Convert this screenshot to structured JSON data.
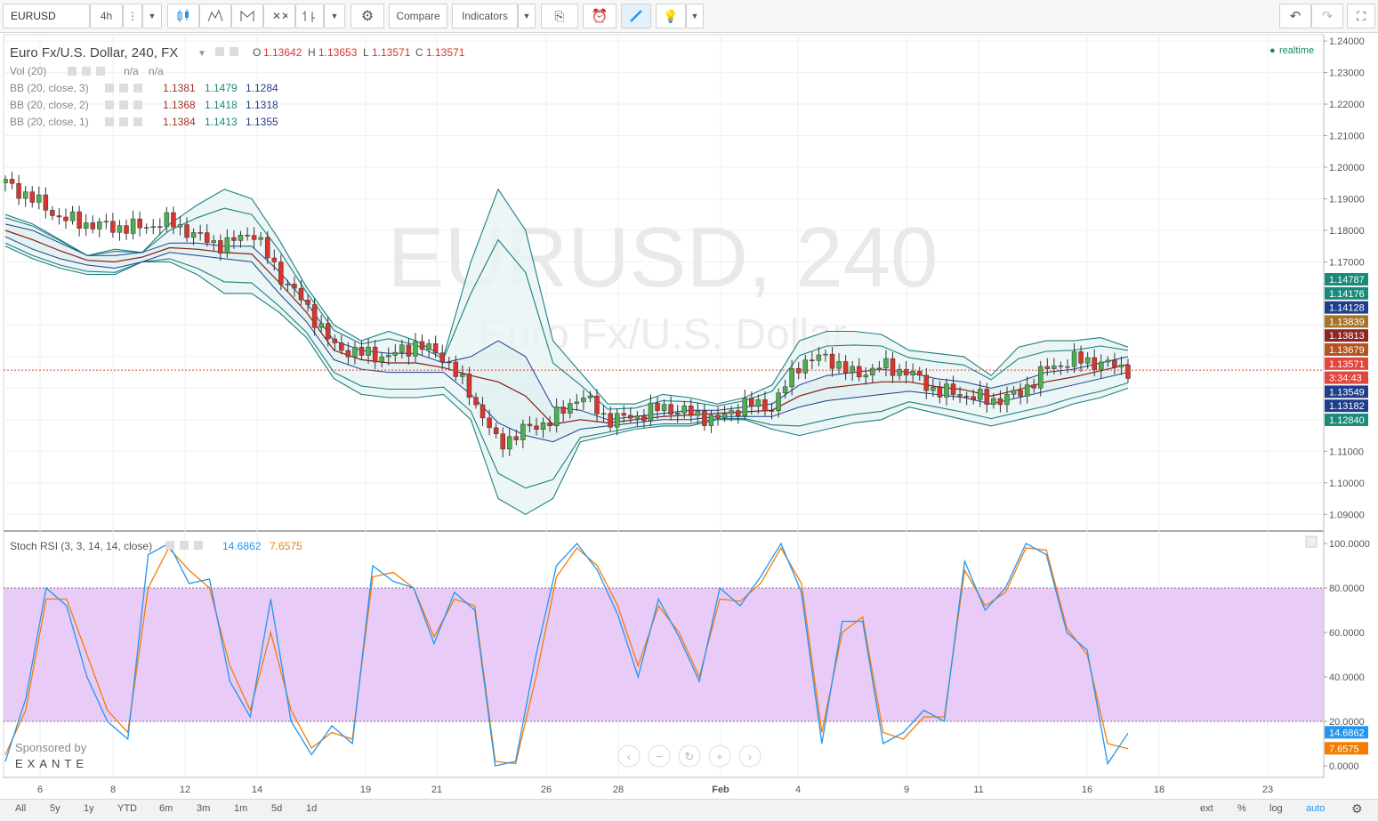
{
  "toolbar": {
    "symbol": "EURUSD",
    "interval": "4h",
    "compare_label": "Compare",
    "indicators_label": "Indicators"
  },
  "legend": {
    "title": "Euro Fx/U.S. Dollar, 240, FX",
    "o_label": "O",
    "o": "1.13642",
    "h_label": "H",
    "h": "1.13653",
    "l_label": "L",
    "l": "1.13571",
    "c_label": "C",
    "c": "1.13571",
    "vol_label": "Vol (20)",
    "vol_v1": "n/a",
    "vol_v2": "n/a",
    "bb": [
      {
        "label": "BB (20, close, 3)",
        "v1": "1.1381",
        "v2": "1.1479",
        "v3": "1.1284"
      },
      {
        "label": "BB (20, close, 2)",
        "v1": "1.1368",
        "v2": "1.1418",
        "v3": "1.1318"
      },
      {
        "label": "BB (20, close, 1)",
        "v1": "1.1384",
        "v2": "1.1413",
        "v3": "1.1355"
      }
    ],
    "realtime": "realtime"
  },
  "watermark": {
    "main": "EURUSD, 240",
    "sub": "Euro Fx/U.S. Dollar"
  },
  "stoch": {
    "label": "Stoch RSI (3, 3, 14, 14, close)",
    "k": "14.6862",
    "d": "7.6575"
  },
  "sponsor": {
    "line1": "Sponsored by",
    "line2": "EXANTE"
  },
  "price_axis": {
    "ticks": [
      "1.24000",
      "1.23000",
      "1.22000",
      "1.21000",
      "1.20000",
      "1.19000",
      "1.18000",
      "1.17000",
      "1.11000",
      "1.10000",
      "1.09000"
    ],
    "tags": [
      {
        "text": "1.14787",
        "color": "#1a8a7a"
      },
      {
        "text": "1.14176",
        "color": "#1a8a7a"
      },
      {
        "text": "1.14128",
        "color": "#1f3e8c"
      },
      {
        "text": "1.13839",
        "color": "#a5732a"
      },
      {
        "text": "1.13813",
        "color": "#8f2424"
      },
      {
        "text": "1.13679",
        "color": "#b5541f"
      },
      {
        "text": "1.13571",
        "color": "#e2463c"
      },
      {
        "text": "3:34:43",
        "color": "#e2463c"
      },
      {
        "text": "1.13549",
        "color": "#1f3e8c"
      },
      {
        "text": "1.13182",
        "color": "#1f3e8c"
      },
      {
        "text": "1.12840",
        "color": "#1a8a7a"
      }
    ]
  },
  "stoch_axis": {
    "ticks": [
      "100.0000",
      "80.0000",
      "60.0000",
      "40.0000",
      "20.0000",
      "0.0000"
    ],
    "k_tag": "14.6862",
    "d_tag": "7.6575",
    "k_color": "#2196f3",
    "d_color": "#f57c00"
  },
  "time_axis": [
    "6",
    "8",
    "12",
    "14",
    "19",
    "21",
    "26",
    "28",
    "Feb",
    "4",
    "9",
    "11",
    "16",
    "18",
    "23"
  ],
  "ranges": [
    "All",
    "5y",
    "1y",
    "YTD",
    "6m",
    "3m",
    "1m",
    "5d",
    "1d"
  ],
  "bottom_right": [
    "ext",
    "%",
    "log",
    "auto"
  ],
  "colors": {
    "up": "#4caf50",
    "down": "#d9352c",
    "band": "#1a7f80",
    "band_fill": "#e8f4f4",
    "basis": "#8b1a1a",
    "stoch_bg": "#e8ccf7",
    "last_price": "#e2463c"
  },
  "chart_data": [
    {
      "type": "candlestick",
      "title": "Euro Fx/U.S. Dollar, 240, FX",
      "ylim": [
        1.085,
        1.242
      ],
      "x_ticks": [
        "6",
        "8",
        "12",
        "14",
        "19",
        "21",
        "26",
        "28",
        "Feb",
        "4",
        "9",
        "11",
        "16",
        "18",
        "23"
      ],
      "last_close": 1.13571,
      "series": [
        {
          "name": "BB (20, close, 3) upper",
          "values": [
            1.185,
            1.182,
            1.177,
            1.172,
            1.174,
            1.173,
            1.182,
            1.188,
            1.193,
            1.19,
            1.177,
            1.162,
            1.15,
            1.145,
            1.148,
            1.145,
            1.14,
            1.17,
            1.193,
            1.18,
            1.145,
            1.135,
            1.125,
            1.125,
            1.128,
            1.127,
            1.125,
            1.127,
            1.131,
            1.145,
            1.148,
            1.148,
            1.147,
            1.142,
            1.141,
            1.14,
            1.134,
            1.143,
            1.145,
            1.145,
            1.146,
            1.143
          ]
        },
        {
          "name": "BB (20, close, 3) lower",
          "values": [
            1.175,
            1.171,
            1.168,
            1.166,
            1.166,
            1.17,
            1.17,
            1.166,
            1.16,
            1.16,
            1.154,
            1.146,
            1.133,
            1.128,
            1.127,
            1.127,
            1.128,
            1.12,
            1.095,
            1.09,
            1.095,
            1.113,
            1.115,
            1.117,
            1.118,
            1.118,
            1.12,
            1.12,
            1.117,
            1.115,
            1.117,
            1.119,
            1.12,
            1.124,
            1.122,
            1.12,
            1.118,
            1.12,
            1.122,
            1.125,
            1.127,
            1.13
          ]
        },
        {
          "name": "BB (20, close, 1) upper",
          "values": [
            1.182,
            1.18,
            1.176,
            1.172,
            1.172,
            1.173,
            1.176,
            1.176,
            1.175,
            1.175,
            1.167,
            1.157,
            1.145,
            1.142,
            1.141,
            1.141,
            1.138,
            1.14,
            1.145,
            1.14,
            1.124,
            1.123,
            1.12,
            1.121,
            1.122,
            1.123,
            1.123,
            1.124,
            1.125,
            1.131,
            1.134,
            1.135,
            1.136,
            1.135,
            1.133,
            1.132,
            1.13,
            1.132,
            1.135,
            1.136,
            1.138,
            1.14
          ]
        },
        {
          "name": "BB (20, close, 1) lower",
          "values": [
            1.178,
            1.174,
            1.171,
            1.169,
            1.168,
            1.17,
            1.173,
            1.172,
            1.171,
            1.17,
            1.16,
            1.151,
            1.139,
            1.136,
            1.135,
            1.135,
            1.135,
            1.128,
            1.119,
            1.115,
            1.113,
            1.117,
            1.118,
            1.119,
            1.12,
            1.12,
            1.121,
            1.121,
            1.121,
            1.124,
            1.126,
            1.127,
            1.128,
            1.129,
            1.128,
            1.127,
            1.125,
            1.127,
            1.129,
            1.131,
            1.133,
            1.135
          ]
        },
        {
          "name": "Close",
          "values": [
            1.195,
            1.19,
            1.184,
            1.182,
            1.181,
            1.181,
            1.183,
            1.178,
            1.175,
            1.18,
            1.166,
            1.156,
            1.143,
            1.141,
            1.14,
            1.144,
            1.14,
            1.128,
            1.112,
            1.117,
            1.12,
            1.128,
            1.12,
            1.121,
            1.124,
            1.122,
            1.12,
            1.125,
            1.124,
            1.138,
            1.14,
            1.134,
            1.137,
            1.135,
            1.129,
            1.128,
            1.126,
            1.128,
            1.136,
            1.139,
            1.138,
            1.136
          ]
        }
      ]
    },
    {
      "type": "line",
      "title": "Stoch RSI (3, 3, 14, 14, close)",
      "ylim": [
        0,
        100
      ],
      "series": [
        {
          "name": "K",
          "values": [
            2,
            30,
            80,
            72,
            40,
            20,
            12,
            95,
            100,
            82,
            84,
            38,
            22,
            75,
            20,
            5,
            18,
            10,
            90,
            83,
            80,
            55,
            78,
            70,
            0,
            2,
            50,
            90,
            100,
            88,
            68,
            40,
            75,
            58,
            38,
            80,
            72,
            85,
            100,
            78,
            10,
            65,
            65,
            10,
            15,
            25,
            20,
            92,
            70,
            80,
            100,
            95,
            60,
            52,
            1,
            14.7
          ]
        },
        {
          "name": "D",
          "values": [
            5,
            25,
            75,
            75,
            50,
            25,
            15,
            80,
            98,
            88,
            80,
            45,
            25,
            60,
            25,
            8,
            15,
            12,
            85,
            87,
            80,
            58,
            75,
            72,
            2,
            1,
            40,
            85,
            98,
            90,
            72,
            45,
            72,
            60,
            40,
            75,
            74,
            82,
            98,
            82,
            15,
            60,
            67,
            15,
            12,
            22,
            22,
            88,
            72,
            78,
            98,
            97,
            62,
            50,
            10,
            7.7
          ]
        }
      ]
    }
  ]
}
